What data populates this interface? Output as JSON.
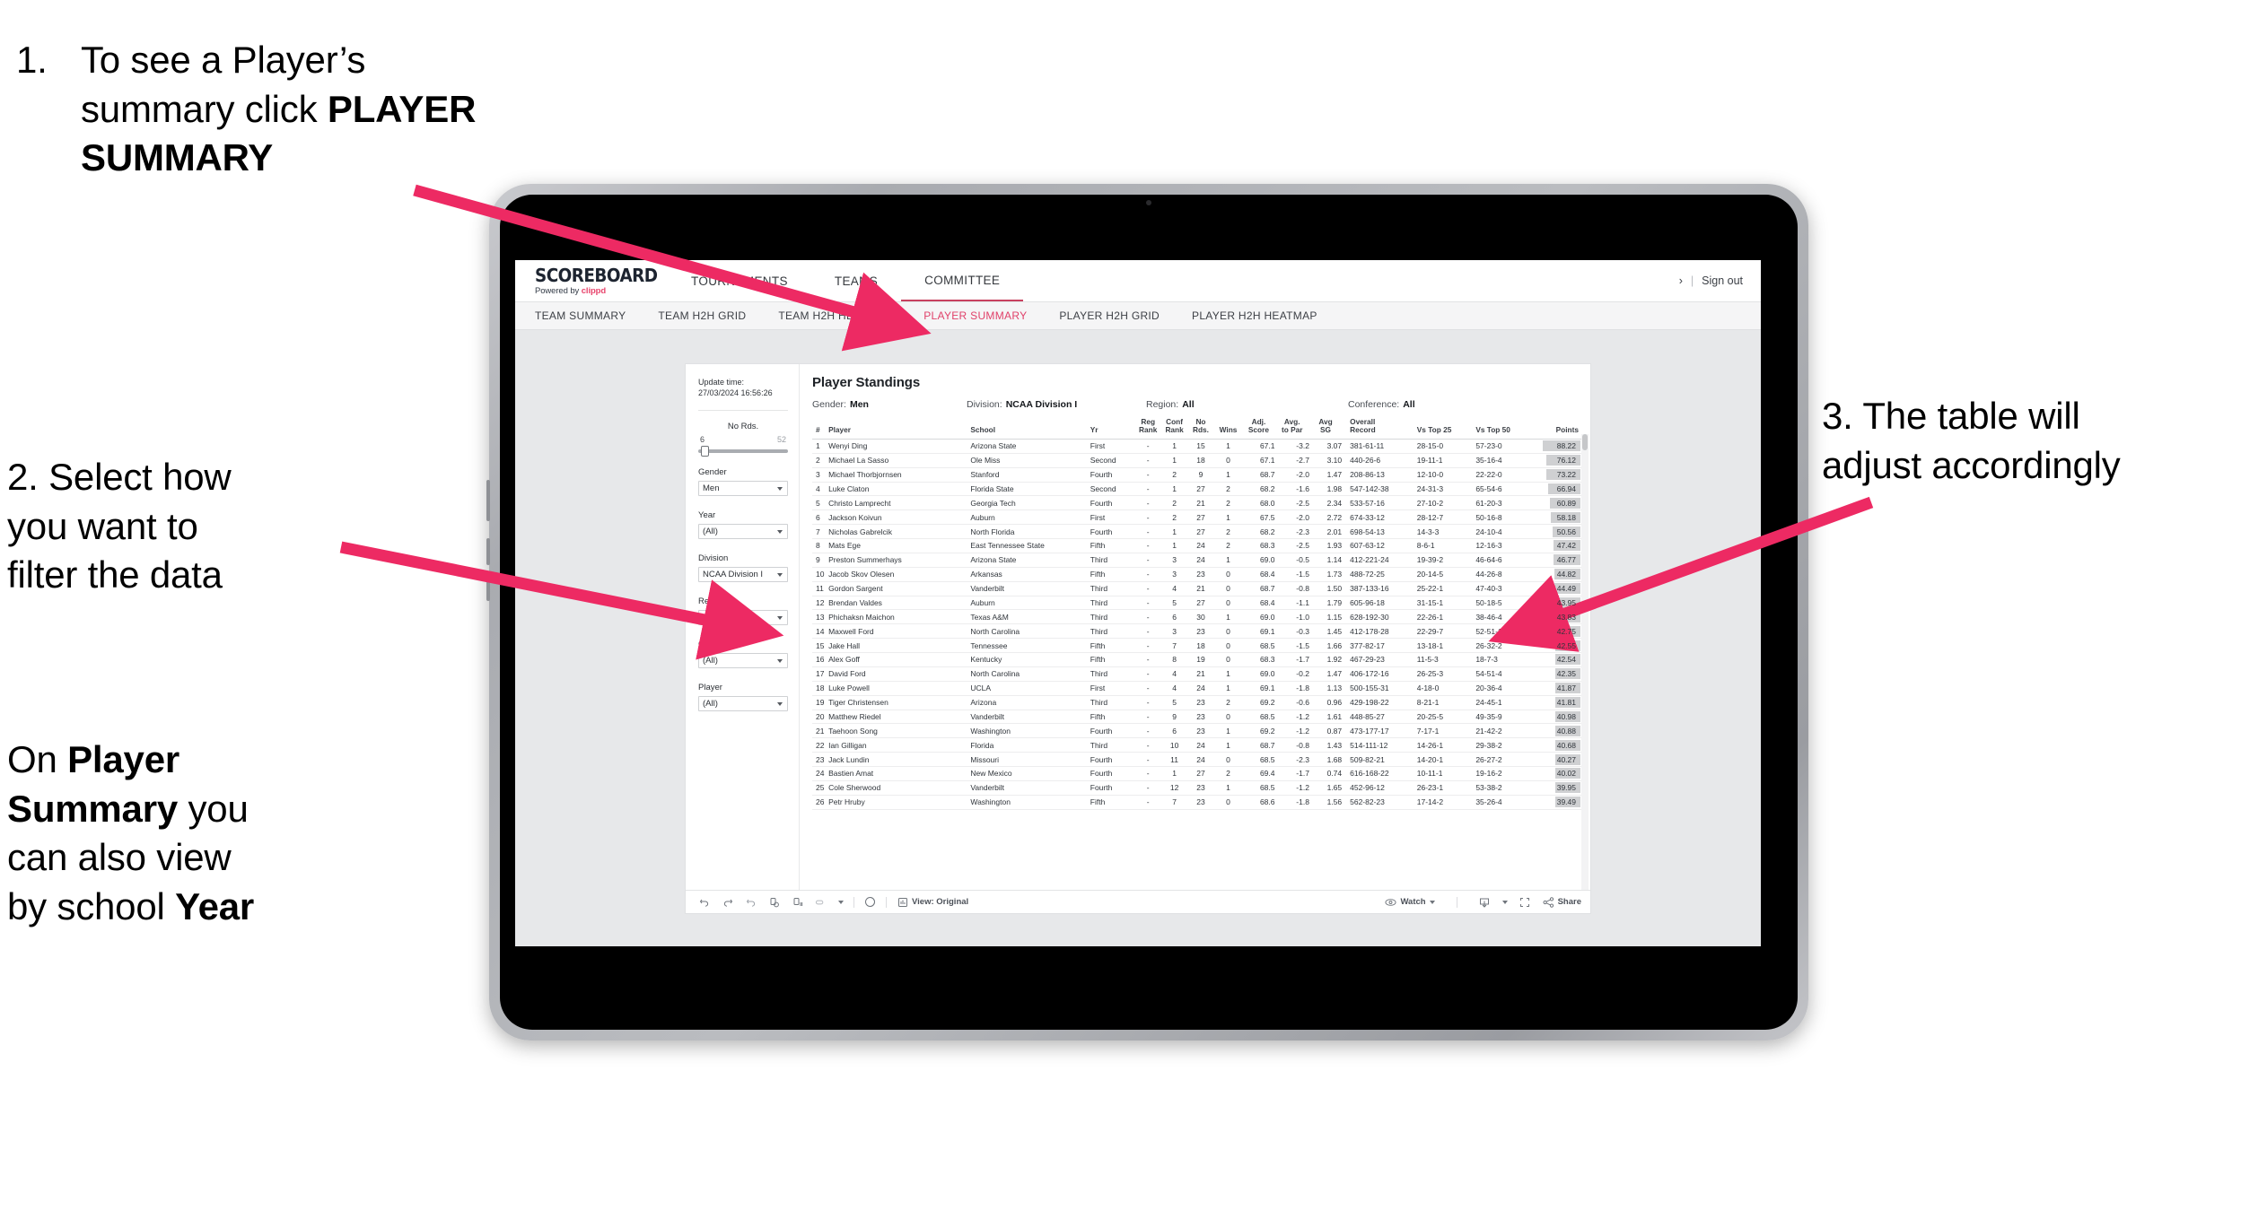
{
  "annotations": {
    "step1": {
      "number": "1.",
      "line1": "To see a Player’s",
      "line2_pre": "summary click ",
      "line2_bold": "PLAYER",
      "line3_bold": "SUMMARY"
    },
    "step2": {
      "line1": "2. Select how",
      "line2": "you want to",
      "line3": "filter the data"
    },
    "step2b": {
      "pre1": "On ",
      "b1": "Player",
      "b2": "Summary",
      "mid": " you",
      "line3": "can also view",
      "line4_pre": "by school ",
      "line4_bold": "Year"
    },
    "step3": {
      "line1": "3. The table will",
      "line2": "adjust accordingly"
    }
  },
  "app": {
    "brand": {
      "title": "SCOREBOARD",
      "sub_pre": "Powered by ",
      "sub_brand": "clippd"
    },
    "topnav": [
      {
        "label": "TOURNAMENTS",
        "active": false
      },
      {
        "label": "TEAMS",
        "active": false
      },
      {
        "label": "COMMITTEE",
        "active": true
      }
    ],
    "header_right": {
      "user": "›",
      "sep": "|",
      "signout": "Sign out"
    },
    "subnav": [
      {
        "label": "TEAM SUMMARY",
        "active": false
      },
      {
        "label": "TEAM H2H GRID",
        "active": false
      },
      {
        "label": "TEAM H2H HEATMAP",
        "active": false
      },
      {
        "label": "PLAYER SUMMARY",
        "active": true
      },
      {
        "label": "PLAYER H2H GRID",
        "active": false
      },
      {
        "label": "PLAYER H2H HEATMAP",
        "active": false
      }
    ]
  },
  "filters": {
    "update_label": "Update time:",
    "update_value": "27/03/2024 16:56:26",
    "slider": {
      "title": "No Rds.",
      "min": "6",
      "max": "52"
    },
    "controls": [
      {
        "label": "Gender",
        "value": "Men"
      },
      {
        "label": "Year",
        "value": "(All)"
      },
      {
        "label": "Division",
        "value": "NCAA Division I"
      },
      {
        "label": "Region",
        "value": "N/A"
      },
      {
        "label": "Conference",
        "value": "(All)"
      },
      {
        "label": "Player",
        "value": "(All)"
      }
    ]
  },
  "viz": {
    "title": "Player Standings",
    "subtitle": [
      {
        "label": "Gender:",
        "value": "Men"
      },
      {
        "label": "Division:",
        "value": "NCAA Division I"
      },
      {
        "label": "Region:",
        "value": "All"
      },
      {
        "label": "Conference:",
        "value": "All"
      }
    ],
    "toolbar": {
      "view_label": "View: Original",
      "watch_label": "Watch",
      "share_label": "Share"
    }
  },
  "chart_data": {
    "type": "table",
    "title": "Player Standings",
    "columns": [
      "#",
      "Player",
      "School",
      "Yr",
      "Reg Rank",
      "Conf Rank",
      "No Rds.",
      "Wins",
      "Adj. Score",
      "Avg. to Par",
      "Avg SG",
      "Overall Record",
      "Vs Top 25",
      "Vs Top 50",
      "Points"
    ],
    "column_headers_wrapped": [
      {
        "l1": "#",
        "l2": ""
      },
      {
        "l1": "Player",
        "l2": ""
      },
      {
        "l1": "School",
        "l2": ""
      },
      {
        "l1": "Yr",
        "l2": ""
      },
      {
        "l1": "Reg",
        "l2": "Rank"
      },
      {
        "l1": "Conf",
        "l2": "Rank"
      },
      {
        "l1": "No",
        "l2": "Rds."
      },
      {
        "l1": "Wins",
        "l2": ""
      },
      {
        "l1": "Adj.",
        "l2": "Score"
      },
      {
        "l1": "Avg.",
        "l2": "to Par"
      },
      {
        "l1": "Avg",
        "l2": "SG"
      },
      {
        "l1": "Overall",
        "l2": "Record"
      },
      {
        "l1": "Vs Top 25",
        "l2": ""
      },
      {
        "l1": "Vs Top 50",
        "l2": ""
      },
      {
        "l1": "Points",
        "l2": ""
      }
    ],
    "rows": [
      {
        "rank": "1",
        "player": "Wenyi Ding",
        "school": "Arizona State",
        "yr": "First",
        "reg": "-",
        "conf": "1",
        "rds": "15",
        "wins": "1",
        "adj": "67.1",
        "par": "-3.2",
        "sg": "3.07",
        "record": "381-61-11",
        "t25": "28-15-0",
        "t50": "57-23-0",
        "points": 88.22
      },
      {
        "rank": "2",
        "player": "Michael La Sasso",
        "school": "Ole Miss",
        "yr": "Second",
        "reg": "-",
        "conf": "1",
        "rds": "18",
        "wins": "0",
        "adj": "67.1",
        "par": "-2.7",
        "sg": "3.10",
        "record": "440-26-6",
        "t25": "19-11-1",
        "t50": "35-16-4",
        "points": 76.12
      },
      {
        "rank": "3",
        "player": "Michael Thorbjornsen",
        "school": "Stanford",
        "yr": "Fourth",
        "reg": "-",
        "conf": "2",
        "rds": "9",
        "wins": "1",
        "adj": "68.7",
        "par": "-2.0",
        "sg": "1.47",
        "record": "208-86-13",
        "t25": "12-10-0",
        "t50": "22-22-0",
        "points": 73.22
      },
      {
        "rank": "4",
        "player": "Luke Claton",
        "school": "Florida State",
        "yr": "Second",
        "reg": "-",
        "conf": "1",
        "rds": "27",
        "wins": "2",
        "adj": "68.2",
        "par": "-1.6",
        "sg": "1.98",
        "record": "547-142-38",
        "t25": "24-31-3",
        "t50": "65-54-6",
        "points": 66.94
      },
      {
        "rank": "5",
        "player": "Christo Lamprecht",
        "school": "Georgia Tech",
        "yr": "Fourth",
        "reg": "-",
        "conf": "2",
        "rds": "21",
        "wins": "2",
        "adj": "68.0",
        "par": "-2.5",
        "sg": "2.34",
        "record": "533-57-16",
        "t25": "27-10-2",
        "t50": "61-20-3",
        "points": 60.89
      },
      {
        "rank": "6",
        "player": "Jackson Koivun",
        "school": "Auburn",
        "yr": "First",
        "reg": "-",
        "conf": "2",
        "rds": "27",
        "wins": "1",
        "adj": "67.5",
        "par": "-2.0",
        "sg": "2.72",
        "record": "674-33-12",
        "t25": "28-12-7",
        "t50": "50-16-8",
        "points": 58.18
      },
      {
        "rank": "7",
        "player": "Nicholas Gabrelcik",
        "school": "North Florida",
        "yr": "Fourth",
        "reg": "-",
        "conf": "1",
        "rds": "27",
        "wins": "2",
        "adj": "68.2",
        "par": "-2.3",
        "sg": "2.01",
        "record": "698-54-13",
        "t25": "14-3-3",
        "t50": "24-10-4",
        "points": 50.56
      },
      {
        "rank": "8",
        "player": "Mats Ege",
        "school": "East Tennessee State",
        "yr": "Fifth",
        "reg": "-",
        "conf": "1",
        "rds": "24",
        "wins": "2",
        "adj": "68.3",
        "par": "-2.5",
        "sg": "1.93",
        "record": "607-63-12",
        "t25": "8-6-1",
        "t50": "12-16-3",
        "points": 47.42
      },
      {
        "rank": "9",
        "player": "Preston Summerhays",
        "school": "Arizona State",
        "yr": "Third",
        "reg": "-",
        "conf": "3",
        "rds": "24",
        "wins": "1",
        "adj": "69.0",
        "par": "-0.5",
        "sg": "1.14",
        "record": "412-221-24",
        "t25": "19-39-2",
        "t50": "46-64-6",
        "points": 46.77
      },
      {
        "rank": "10",
        "player": "Jacob Skov Olesen",
        "school": "Arkansas",
        "yr": "Fifth",
        "reg": "-",
        "conf": "3",
        "rds": "23",
        "wins": "0",
        "adj": "68.4",
        "par": "-1.5",
        "sg": "1.73",
        "record": "488-72-25",
        "t25": "20-14-5",
        "t50": "44-26-8",
        "points": 44.82
      },
      {
        "rank": "11",
        "player": "Gordon Sargent",
        "school": "Vanderbilt",
        "yr": "Third",
        "reg": "-",
        "conf": "4",
        "rds": "21",
        "wins": "0",
        "adj": "68.7",
        "par": "-0.8",
        "sg": "1.50",
        "record": "387-133-16",
        "t25": "25-22-1",
        "t50": "47-40-3",
        "points": 44.49
      },
      {
        "rank": "12",
        "player": "Brendan Valdes",
        "school": "Auburn",
        "yr": "Third",
        "reg": "-",
        "conf": "5",
        "rds": "27",
        "wins": "0",
        "adj": "68.4",
        "par": "-1.1",
        "sg": "1.79",
        "record": "605-96-18",
        "t25": "31-15-1",
        "t50": "50-18-5",
        "points": 43.95
      },
      {
        "rank": "13",
        "player": "Phichaksn Maichon",
        "school": "Texas A&M",
        "yr": "Third",
        "reg": "-",
        "conf": "6",
        "rds": "30",
        "wins": "1",
        "adj": "69.0",
        "par": "-1.0",
        "sg": "1.15",
        "record": "628-192-30",
        "t25": "22-26-1",
        "t50": "38-46-4",
        "points": 43.83
      },
      {
        "rank": "14",
        "player": "Maxwell Ford",
        "school": "North Carolina",
        "yr": "Third",
        "reg": "-",
        "conf": "3",
        "rds": "23",
        "wins": "0",
        "adj": "69.1",
        "par": "-0.3",
        "sg": "1.45",
        "record": "412-178-28",
        "t25": "22-29-7",
        "t50": "52-51-10",
        "points": 42.75
      },
      {
        "rank": "15",
        "player": "Jake Hall",
        "school": "Tennessee",
        "yr": "Fifth",
        "reg": "-",
        "conf": "7",
        "rds": "18",
        "wins": "0",
        "adj": "68.5",
        "par": "-1.5",
        "sg": "1.66",
        "record": "377-82-17",
        "t25": "13-18-1",
        "t50": "26-32-2",
        "points": 42.55
      },
      {
        "rank": "16",
        "player": "Alex Goff",
        "school": "Kentucky",
        "yr": "Fifth",
        "reg": "-",
        "conf": "8",
        "rds": "19",
        "wins": "0",
        "adj": "68.3",
        "par": "-1.7",
        "sg": "1.92",
        "record": "467-29-23",
        "t25": "11-5-3",
        "t50": "18-7-3",
        "points": 42.54
      },
      {
        "rank": "17",
        "player": "David Ford",
        "school": "North Carolina",
        "yr": "Third",
        "reg": "-",
        "conf": "4",
        "rds": "21",
        "wins": "1",
        "adj": "69.0",
        "par": "-0.2",
        "sg": "1.47",
        "record": "406-172-16",
        "t25": "26-25-3",
        "t50": "54-51-4",
        "points": 42.35
      },
      {
        "rank": "18",
        "player": "Luke Powell",
        "school": "UCLA",
        "yr": "First",
        "reg": "-",
        "conf": "4",
        "rds": "24",
        "wins": "1",
        "adj": "69.1",
        "par": "-1.8",
        "sg": "1.13",
        "record": "500-155-31",
        "t25": "4-18-0",
        "t50": "20-36-4",
        "points": 41.87
      },
      {
        "rank": "19",
        "player": "Tiger Christensen",
        "school": "Arizona",
        "yr": "Third",
        "reg": "-",
        "conf": "5",
        "rds": "23",
        "wins": "2",
        "adj": "69.2",
        "par": "-0.6",
        "sg": "0.96",
        "record": "429-198-22",
        "t25": "8-21-1",
        "t50": "24-45-1",
        "points": 41.81
      },
      {
        "rank": "20",
        "player": "Matthew Riedel",
        "school": "Vanderbilt",
        "yr": "Fifth",
        "reg": "-",
        "conf": "9",
        "rds": "23",
        "wins": "0",
        "adj": "68.5",
        "par": "-1.2",
        "sg": "1.61",
        "record": "448-85-27",
        "t25": "20-25-5",
        "t50": "49-35-9",
        "points": 40.98
      },
      {
        "rank": "21",
        "player": "Taehoon Song",
        "school": "Washington",
        "yr": "Fourth",
        "reg": "-",
        "conf": "6",
        "rds": "23",
        "wins": "1",
        "adj": "69.2",
        "par": "-1.2",
        "sg": "0.87",
        "record": "473-177-17",
        "t25": "7-17-1",
        "t50": "21-42-2",
        "points": 40.88
      },
      {
        "rank": "22",
        "player": "Ian Gilligan",
        "school": "Florida",
        "yr": "Third",
        "reg": "-",
        "conf": "10",
        "rds": "24",
        "wins": "1",
        "adj": "68.7",
        "par": "-0.8",
        "sg": "1.43",
        "record": "514-111-12",
        "t25": "14-26-1",
        "t50": "29-38-2",
        "points": 40.68
      },
      {
        "rank": "23",
        "player": "Jack Lundin",
        "school": "Missouri",
        "yr": "Fourth",
        "reg": "-",
        "conf": "11",
        "rds": "24",
        "wins": "0",
        "adj": "68.5",
        "par": "-2.3",
        "sg": "1.68",
        "record": "509-82-21",
        "t25": "14-20-1",
        "t50": "26-27-2",
        "points": 40.27
      },
      {
        "rank": "24",
        "player": "Bastien Amat",
        "school": "New Mexico",
        "yr": "Fourth",
        "reg": "-",
        "conf": "1",
        "rds": "27",
        "wins": "2",
        "adj": "69.4",
        "par": "-1.7",
        "sg": "0.74",
        "record": "616-168-22",
        "t25": "10-11-1",
        "t50": "19-16-2",
        "points": 40.02
      },
      {
        "rank": "25",
        "player": "Cole Sherwood",
        "school": "Vanderbilt",
        "yr": "Fourth",
        "reg": "-",
        "conf": "12",
        "rds": "23",
        "wins": "1",
        "adj": "68.5",
        "par": "-1.2",
        "sg": "1.65",
        "record": "452-96-12",
        "t25": "26-23-1",
        "t50": "53-38-2",
        "points": 39.95
      },
      {
        "rank": "26",
        "player": "Petr Hruby",
        "school": "Washington",
        "yr": "Fifth",
        "reg": "-",
        "conf": "7",
        "rds": "23",
        "wins": "0",
        "adj": "68.6",
        "par": "-1.8",
        "sg": "1.56",
        "record": "562-82-23",
        "t25": "17-14-2",
        "t50": "35-26-4",
        "points": 39.49
      }
    ],
    "points_max": 88.22,
    "ylabel": "",
    "xlabel": ""
  },
  "colors": {
    "accent": "#e8446c",
    "active_tab": "#e0416a",
    "arrow": "#ed2a63",
    "points_bar": "#cfd0d2"
  }
}
